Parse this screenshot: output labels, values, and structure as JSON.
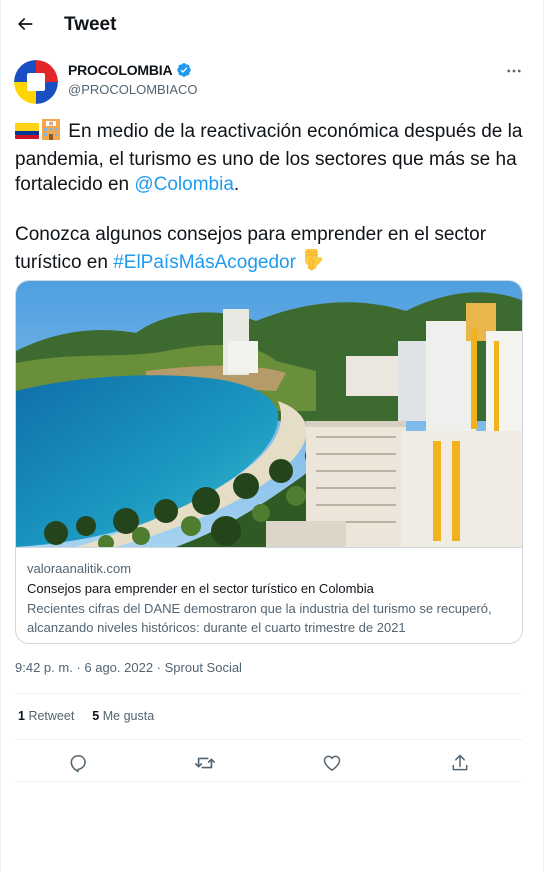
{
  "header": {
    "title": "Tweet"
  },
  "author": {
    "display_name": "PROCOLOMBIA",
    "handle": "@PROCOLOMBIACO"
  },
  "tweet": {
    "p1_emoji_alt": "🇨🇴🏨",
    "p1_text_a": " En medio de la reactivación económica después de la pandemia, el turismo es uno de los sectores que más se ha fortalecido en ",
    "p1_mention": "@Colombia",
    "p1_text_b": ".",
    "p2_text_a": "Conozca algunos consejos para emprender en el sector turístico en ",
    "p2_hashtag": "#ElPaísMásAcogedor",
    "p2_emoji": "👇"
  },
  "card": {
    "domain": "valoraanalitik.com",
    "title": "Consejos para emprender en el sector turístico en Colombia",
    "description": "Recientes cifras del DANE demostraron que la industria del turismo se recuperó, alcanzando niveles históricos: durante el cuarto trimestre de 2021"
  },
  "meta": {
    "time": "9:42 p. m.",
    "sep": " · ",
    "date": "6 ago. 2022",
    "source": "Sprout Social"
  },
  "stats": {
    "retweets_count": "1",
    "retweets_label": "Retweet",
    "likes_count": "5",
    "likes_label": "Me gusta"
  },
  "icons": [
    "back-arrow-icon",
    "verified-badge-icon",
    "more-icon",
    "reply-icon",
    "retweet-icon",
    "like-icon",
    "share-icon"
  ],
  "colors": {
    "link": "#1d9bf0",
    "verified": "#1d9bf0",
    "secondary_text": "#536471",
    "border": "#cfd9de"
  }
}
